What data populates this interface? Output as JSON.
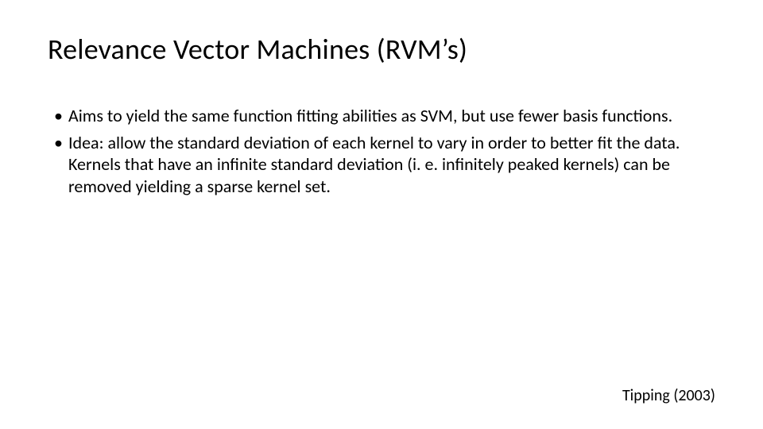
{
  "slide": {
    "title": "Relevance Vector Machines (RVM’s)",
    "bullets": [
      "Aims to yield the same function fitting abilities as SVM, but use fewer basis functions.",
      "Idea: allow the standard deviation of each kernel to vary in order to better fit the data. Kernels that have an infinite standard deviation (i. e. infinitely peaked kernels) can be removed yielding a sparse kernel set."
    ],
    "citation": "Tipping (2003)"
  }
}
